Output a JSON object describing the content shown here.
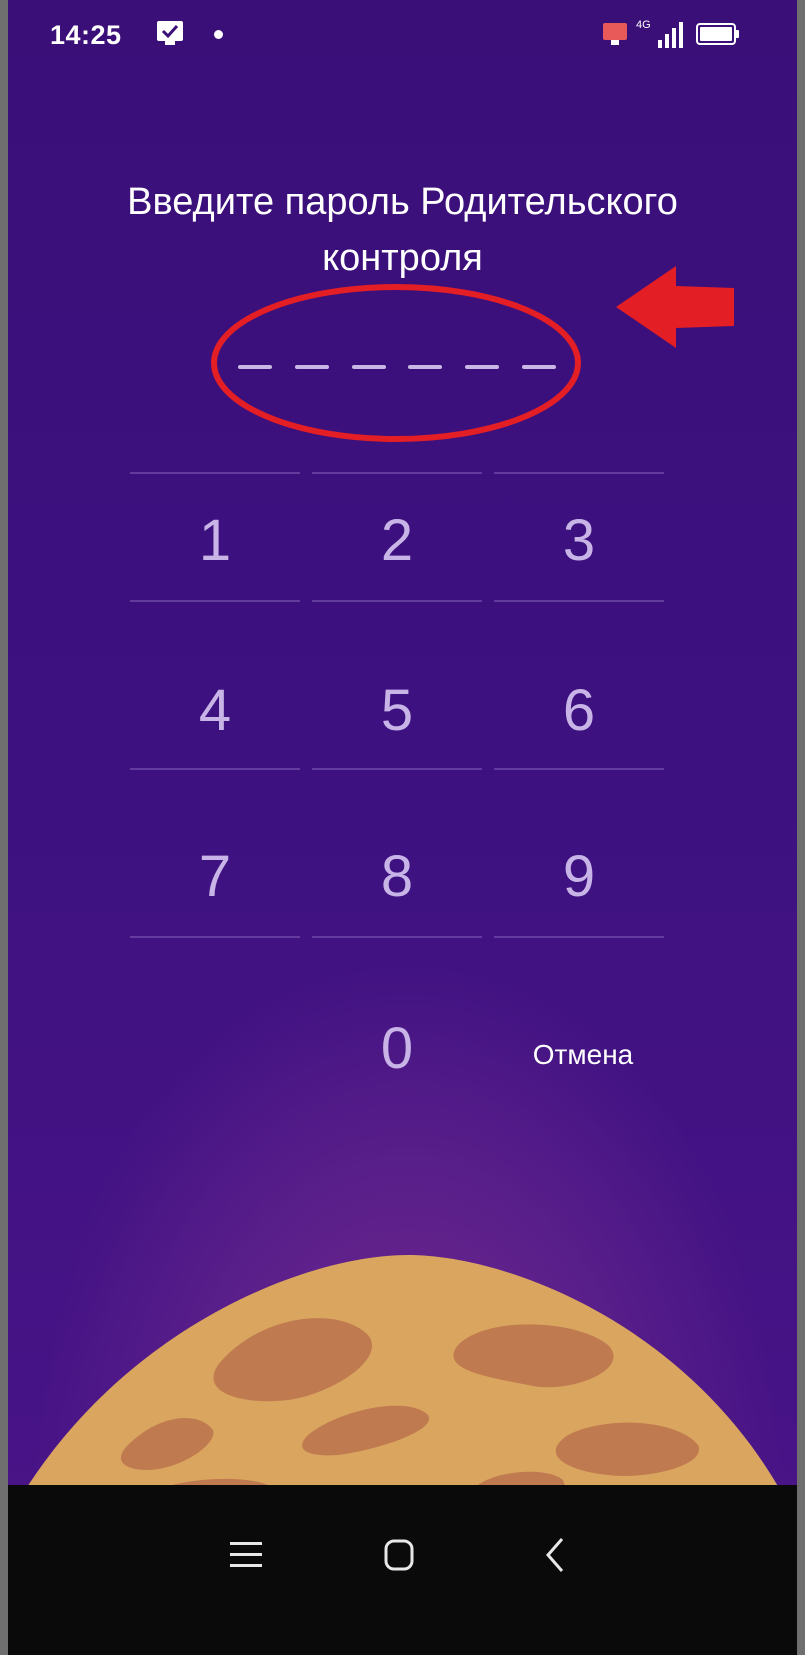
{
  "status_bar": {
    "time": "14:25",
    "network": "4G",
    "icons": [
      "check-notification-icon",
      "dot-icon",
      "cast-icon",
      "signal-icon",
      "battery-icon"
    ]
  },
  "prompt": {
    "title": "Введите пароль Родительского контроля",
    "pin_length": 6,
    "pin_entered": 0
  },
  "keypad": {
    "keys": [
      "1",
      "2",
      "3",
      "4",
      "5",
      "6",
      "7",
      "8",
      "9",
      "0"
    ],
    "cancel_label": "Отмена"
  },
  "annotation": {
    "highlight_color": "#e31e24",
    "shapes": [
      "ellipse-around-pin",
      "arrow-pointing-left"
    ]
  },
  "nav_bar": {
    "buttons": [
      "menu-icon",
      "home-icon",
      "back-icon"
    ]
  },
  "colors": {
    "background_top": "#3a0f78",
    "background_bottom": "#4a1488",
    "key_text": "#c8b4e6",
    "planet": "#d9a55f",
    "planet_spots": "#c07a50"
  }
}
